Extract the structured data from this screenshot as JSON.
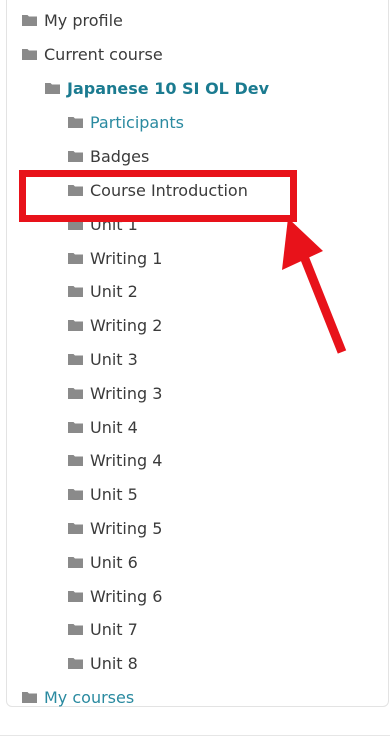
{
  "nav": {
    "my_profile": "My profile",
    "current_course": "Current course",
    "course_name": "Japanese 10 SI OL Dev",
    "participants": "Participants",
    "badges": "Badges",
    "course_introduction": "Course Introduction",
    "sections": [
      "Unit 1",
      "Writing 1",
      "Unit 2",
      "Writing 2",
      "Unit 3",
      "Writing 3",
      "Unit 4",
      "Writing 4",
      "Unit 5",
      "Writing 5",
      "Unit 6",
      "Writing 6",
      "Unit 7",
      "Unit 8"
    ],
    "my_courses": "My courses"
  },
  "icons": {
    "folder": "folder-icon"
  },
  "colors": {
    "link": "#2a8aa0",
    "bold_link": "#1b7b90",
    "text": "#3b3b3b",
    "icon": "#8a8a8a",
    "highlight": "#e8121a"
  }
}
